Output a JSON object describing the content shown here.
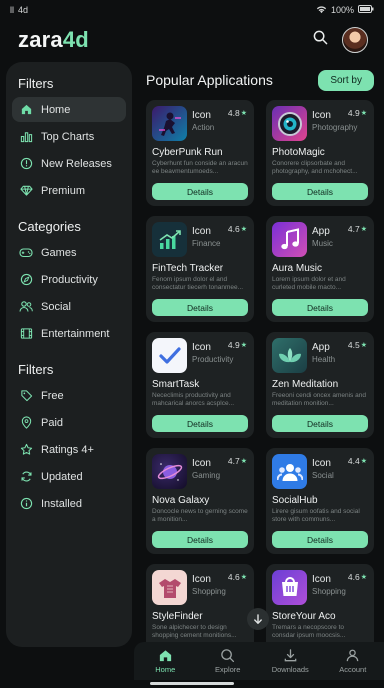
{
  "status_bar": {
    "carrier": "ll",
    "network": "4d",
    "battery": "100%"
  },
  "header": {
    "logo_main": "zara",
    "logo_accent": "4d"
  },
  "sidebar": {
    "filters_heading": "Filters",
    "nav_items": [
      {
        "label": "Home",
        "icon": "home-icon",
        "active": true
      },
      {
        "label": "Top Charts",
        "icon": "bar-chart-icon"
      },
      {
        "label": "New Releases",
        "icon": "clock-icon"
      },
      {
        "label": "Premium",
        "icon": "diamond-icon"
      }
    ],
    "categories_heading": "Categories",
    "categories": [
      {
        "label": "Games",
        "icon": "gamepad-icon"
      },
      {
        "label": "Productivity",
        "icon": "compass-icon"
      },
      {
        "label": "Social",
        "icon": "users-icon"
      },
      {
        "label": "Entertainment",
        "icon": "film-icon"
      }
    ],
    "filters2_heading": "Filters",
    "filters": [
      {
        "label": "Free",
        "icon": "tag-icon"
      },
      {
        "label": "Paid",
        "icon": "location-pin-icon"
      },
      {
        "label": "Ratings 4+",
        "icon": "star-icon"
      },
      {
        "label": "Updated",
        "icon": "refresh-icon"
      },
      {
        "label": "Installed",
        "icon": "info-icon"
      }
    ]
  },
  "main": {
    "title": "Popular Applications",
    "sort_label": "Sort by",
    "details_label": "Details",
    "apps": [
      {
        "icon_label": "Icon",
        "category": "Action",
        "rating": "4.8",
        "name": "CyberPunk Run",
        "desc": "Cyberhunt fun conside an aracun ee beavmentumoeds...",
        "icon": "cyberpunk-icon"
      },
      {
        "icon_label": "Icon",
        "category": "Photography",
        "rating": "4.9",
        "name": "PhotoMagic",
        "desc": "Conorere clipsorbate and photography, and mchohect...",
        "icon": "camera-lens-icon"
      },
      {
        "icon_label": "Icon",
        "category": "Finance",
        "rating": "4.6",
        "name": "FinTech Tracker",
        "desc": "Fenom ipsum dolor el and consectatur tiecerh tonanmee...",
        "icon": "finance-chart-icon"
      },
      {
        "icon_label": "App",
        "category": "Music",
        "rating": "4.7",
        "name": "Aura Music",
        "desc": "Lorem ipsum dolor et and curleted mobile macto...",
        "icon": "music-note-icon"
      },
      {
        "icon_label": "Icon",
        "category": "Productivity",
        "rating": "4.9",
        "name": "SmartTask",
        "desc": "Nececlimis productivity and mahcarical anorcs acsplce...",
        "icon": "checkmark-icon"
      },
      {
        "icon_label": "App",
        "category": "Health",
        "rating": "4.5",
        "name": "Zen Meditation",
        "desc": "Freeoni cendi oncex amenis and meditation monition...",
        "icon": "lotus-icon"
      },
      {
        "icon_label": "Icon",
        "category": "Gaming",
        "rating": "4.7",
        "name": "Nova Galaxy",
        "desc": "Doncocle news to gerning scome a monition...",
        "icon": "planet-icon"
      },
      {
        "icon_label": "Icon",
        "category": "Social",
        "rating": "4.4",
        "name": "SocialHub",
        "desc": "Lirere gisum oofatis and social store with communs...",
        "icon": "group-icon"
      },
      {
        "icon_label": "Icon",
        "category": "Shopping",
        "rating": "4.6",
        "name": "StyleFinder",
        "desc": "Sone alpichecer to design shopping cement monitions...",
        "icon": "shirt-icon"
      },
      {
        "icon_label": "Icon",
        "category": "Shopping",
        "rating": "4.6",
        "name": "StoreYour Aco",
        "desc": "Tremars a necopscore to consdar ipsum moocsis...",
        "icon": "store-icon"
      }
    ]
  },
  "bottom_nav": [
    {
      "label": "Home",
      "icon": "home-icon",
      "active": true
    },
    {
      "label": "Explore",
      "icon": "search-icon"
    },
    {
      "label": "Downloads",
      "icon": "download-icon"
    },
    {
      "label": "Account",
      "icon": "person-icon"
    }
  ],
  "colors": {
    "accent": "#7de2b0",
    "background": "#0d0f10",
    "panel": "#1c1f20",
    "card": "#1e2223"
  }
}
